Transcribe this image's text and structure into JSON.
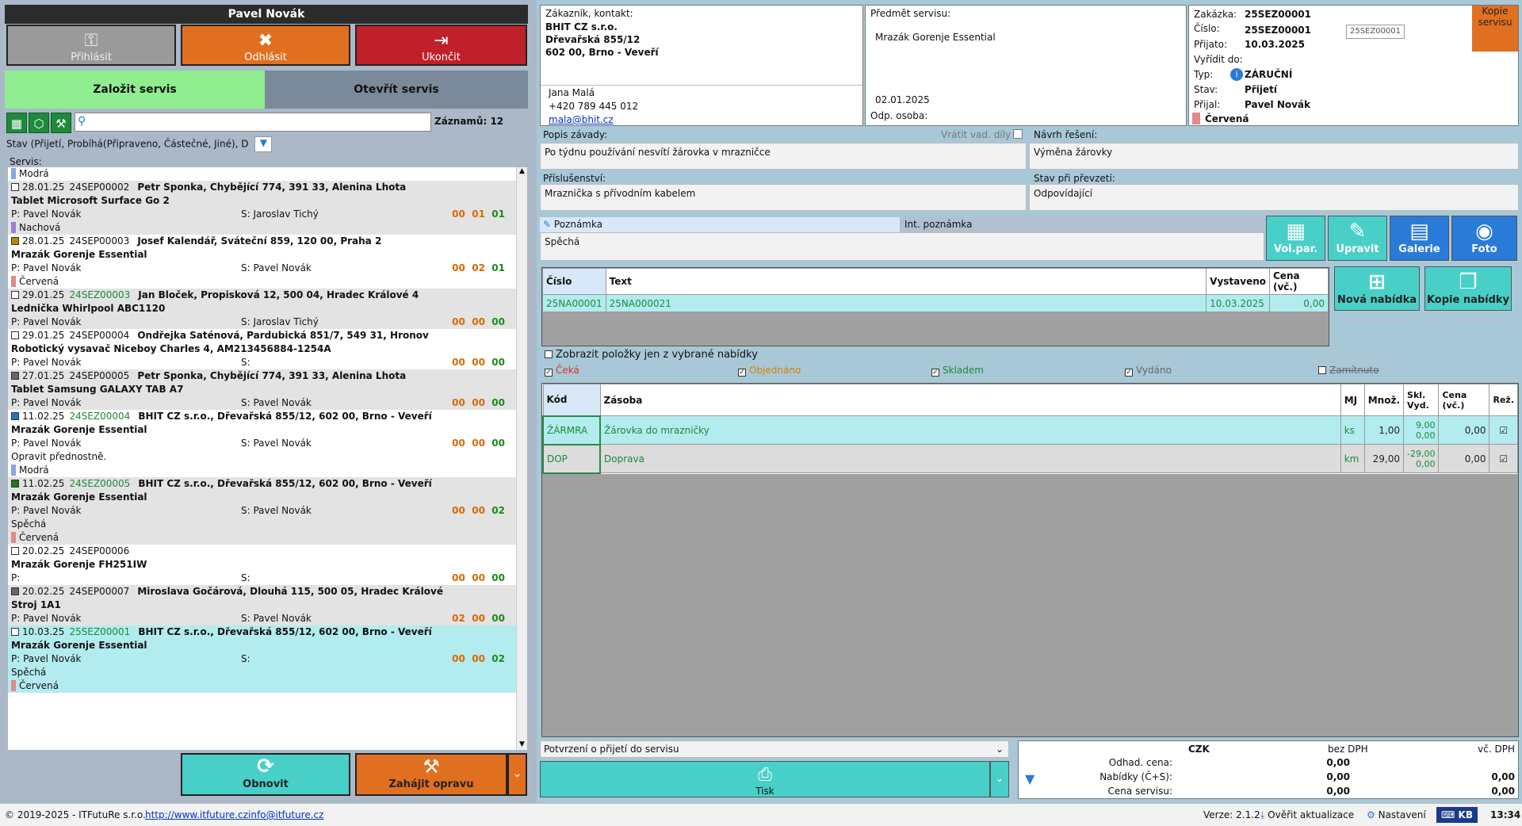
{
  "left": {
    "user_name": "Pavel Novák",
    "buttons": {
      "login": "Přihlásit",
      "logout": "Odhlásit",
      "exit": "Ukončit"
    },
    "tabs": {
      "new_service": "Založit servis",
      "open_service": "Otevřít servis"
    },
    "records": "Záznamů: 12",
    "filter_text": "Stav (Přijetí, Probíhá(Připraveno, Částečné, Jiné), D",
    "list_label": "Servis:",
    "top_partial_color": "Modrá",
    "items": [
      {
        "date": "28.01.25",
        "code": "24SEP00002",
        "code_green": false,
        "customer": "Petr Sponka, Chybějící 774, 391 33, Alenina Lhota",
        "device": "Tablet Microsoft Surface Go 2",
        "p": "P: Pavel Novák",
        "s": "S: Jaroslav Tichý",
        "c1": "00",
        "c2": "01",
        "c3": "01",
        "note": "",
        "color": "Nachová",
        "swatch": "#9b7fd0",
        "box": "#fff"
      },
      {
        "date": "28.01.25",
        "code": "24SEP00003",
        "code_green": false,
        "customer": "Josef Kalendář, Sváteční 859, 120 00, Praha 2",
        "device": "Mrazák Gorenje Essential",
        "p": "P: Pavel Novák",
        "s": "S: Pavel Novák",
        "c1": "00",
        "c2": "02",
        "c3": "01",
        "note": "",
        "color": "Červená",
        "swatch": "#e08a8a",
        "box": "#b8860b"
      },
      {
        "date": "29.01.25",
        "code": "24SEZ00003",
        "code_green": true,
        "customer": "Jan Bloček, Propisková 12, 500 04, Hradec Králové 4",
        "device": "Lednička Whirlpool ABC1120",
        "p": "P: Pavel Novák",
        "s": "S: Jaroslav Tichý",
        "c1": "00",
        "c2": "00",
        "c3": "00",
        "note": "",
        "color": "",
        "swatch": "",
        "box": "#fff"
      },
      {
        "date": "29.01.25",
        "code": "24SEP00004",
        "code_green": false,
        "customer": "Ondřejka Saténová, Pardubická 851/7, 549 31, Hronov",
        "device": "Robotický vysavač Niceboy Charles 4, AM213456884-1254A",
        "p": "P: Pavel Novák",
        "s": "S:",
        "c1": "00",
        "c2": "00",
        "c3": "00",
        "note": "",
        "color": "",
        "swatch": "",
        "box": "#fff"
      },
      {
        "date": "27.01.25",
        "code": "24SEP00005",
        "code_green": false,
        "customer": "Petr Sponka, Chybějící 774, 391 33, Alenina Lhota",
        "device": "Tablet Samsung GALAXY TAB A7",
        "p": "P: Pavel Novák",
        "s": "S: Pavel Novák",
        "c1": "00",
        "c2": "00",
        "c3": "00",
        "note": "",
        "color": "",
        "swatch": "",
        "box": "#666"
      },
      {
        "date": "11.02.25",
        "code": "24SEZ00004",
        "code_green": true,
        "customer": "BHIT CZ s.r.o., Dřevařská 855/12, 602 00, Brno - Veveří",
        "device": "Mrazák Gorenje Essential",
        "p": "P: Pavel Novák",
        "s": "S: Pavel Novák",
        "c1": "00",
        "c2": "00",
        "c3": "00",
        "note": "Opravit přednostně.",
        "color": "Modrá",
        "swatch": "#8aa6e0",
        "box": "#2a6fd6"
      },
      {
        "date": "11.02.25",
        "code": "24SEZ00005",
        "code_green": true,
        "customer": "BHIT CZ s.r.o., Dřevařská 855/12, 602 00, Brno - Veveří",
        "device": "Mrazák Gorenje Essential",
        "p": "P: Pavel Novák",
        "s": "S: Pavel Novák",
        "c1": "00",
        "c2": "00",
        "c3": "02",
        "note": "Spěchá",
        "color": "Červená",
        "swatch": "#e08a8a",
        "box": "#1a7a1a"
      },
      {
        "date": "20.02.25",
        "code": "24SEP00006",
        "code_green": false,
        "customer": "",
        "device": "Mrazák Gorenje FH251IW",
        "p": "P:",
        "s": "S:",
        "c1": "00",
        "c2": "00",
        "c3": "00",
        "note": "",
        "color": "",
        "swatch": "",
        "box": "#fff"
      },
      {
        "date": "20.02.25",
        "code": "24SEP00007",
        "code_green": false,
        "customer": "Miroslava Gočárová, Dlouhá 115, 500 05, Hradec Králové",
        "device": "Stroj 1A1",
        "p": "P: Pavel Novák",
        "s": "S: Pavel Novák",
        "c1": "02",
        "c2": "00",
        "c3": "00",
        "note": "",
        "color": "",
        "swatch": "",
        "box": "#666"
      },
      {
        "date": "10.03.25",
        "code": "25SEZ00001",
        "code_green": true,
        "customer": "BHIT CZ s.r.o., Dřevařská 855/12, 602 00, Brno - Veveří",
        "device": "Mrazák Gorenje Essential",
        "p": "P: Pavel Novák",
        "s": "S:",
        "c1": "00",
        "c2": "00",
        "c3": "02",
        "note": "Spěchá",
        "color": "Červená",
        "swatch": "#e08a8a",
        "box": "#fff"
      }
    ],
    "bottom": {
      "refresh": "Obnovit",
      "start_repair": "Zahájit opravu"
    }
  },
  "customer": {
    "label": "Zákazník, kontakt:",
    "name": "BHIT CZ s.r.o.",
    "street": "Dřevařská 855/12",
    "city": "602 00, Brno - Veveří",
    "contact": "Jana Malá",
    "phone": "+420 789 445 012",
    "email": "mala@bhit.cz"
  },
  "subject": {
    "label": "Předmět servisu:",
    "value": "Mrazák Gorenje Essential",
    "date": "02.01.2025",
    "resp_label": "Odp. osoba:"
  },
  "order": {
    "order_label": "Zakázka:",
    "order_value": "25SEZ00001",
    "number_label": "Číslo:",
    "number_value": "25SEZ00001",
    "number_field": "25SEZ00001",
    "received_label": "Přijato:",
    "received_value": "10.03.2025",
    "due_label": "Vyřídit do:",
    "type_label": "Typ:",
    "type_value": "ZÁRUČNÍ",
    "state_label": "Stav:",
    "state_value": "Přijetí",
    "accepted_label": "Přijal:",
    "accepted_value": "Pavel Novák",
    "color_value": "Červená",
    "copy_button": "Kopie servisu"
  },
  "fault": {
    "label": "Popis závady:",
    "return_label": "Vrátit vad. díly",
    "value": "Po týdnu používání nesvítí žárovka v mrazničce"
  },
  "solution": {
    "label": "Návrh řešení:",
    "value": "Výměna žárovky"
  },
  "accessories": {
    "label": "Příslušenství:",
    "value": "Mraznička s přívodním kabelem"
  },
  "handover": {
    "label": "Stav při převzetí:",
    "value": "Odpovídající"
  },
  "note": {
    "tab1": "Poznámka",
    "tab2": "Int. poznámka",
    "value": "Spěchá"
  },
  "actions": {
    "volpar": "Vol.par.",
    "edit": "Upravit",
    "gallery": "Galerie",
    "photo": "Foto"
  },
  "offers": {
    "headers": [
      "Číslo",
      "Text",
      "Vystaveno",
      "Cena (vč.)"
    ],
    "rows": [
      {
        "number": "25NA00001",
        "text": "25NA000021",
        "issued": "10.03.2025",
        "price": "0,00"
      }
    ],
    "new_offer": "Nová nabídka",
    "copy_offer": "Kopie nabídky"
  },
  "filters": {
    "only_selected": "Zobrazit položky jen z vybrané nabídky",
    "waiting": "Čeká",
    "ordered": "Objednáno",
    "in_stock": "Skladem",
    "issued": "Vydáno",
    "rejected": "Zamítnuto"
  },
  "items": {
    "headers": {
      "code": "Kód",
      "stock": "Zásoba",
      "unit": "MJ",
      "qty": "Množ.",
      "skl1": "Skl.",
      "skl2": "Vyd.",
      "price1": "Cena",
      "price2": "(vč.)",
      "rez": "Rež."
    },
    "rows": [
      {
        "code": "ŽÁRMRA",
        "name": "Žárovka do mrazničky",
        "unit": "ks",
        "qty": "1,00",
        "skl": "9,00",
        "vyd": "0,00",
        "price": "0,00"
      },
      {
        "code": "DOP",
        "name": "Doprava",
        "unit": "km",
        "qty": "29,00",
        "skl": "-29,00",
        "vyd": "0,00",
        "price": "0,00"
      }
    ]
  },
  "print": {
    "select_value": "Potvrzení o přijetí do servisu",
    "button": "Tisk"
  },
  "summary": {
    "currency": "CZK",
    "without_vat": "bez DPH",
    "with_vat": "vč. DPH",
    "estimate_label": "Odhad. cena:",
    "estimate_value": "0,00",
    "offers_label": "Nabídky (Č+S):",
    "offers_value": "0,00",
    "offers_vat": "0,00",
    "service_label": "Cena servisu:",
    "service_value": "0,00",
    "service_vat": "0,00"
  },
  "status": {
    "copyright": "© 2019-2025 - ITFutuRe s.r.o.",
    "web": "http://www.itfuture.cz",
    "mail": "info@itfuture.cz",
    "version": "Verze: 2.1.2",
    "check_updates": "Ověřit aktualizace",
    "settings": "Nastavení",
    "kb": "KB",
    "time": "13:34"
  },
  "colors": {
    "green_tab": "#90ee90",
    "orange": "#e07020",
    "red": "#c0202a",
    "teal": "#48d0c8",
    "blue_btn": "#2a7ad8"
  }
}
